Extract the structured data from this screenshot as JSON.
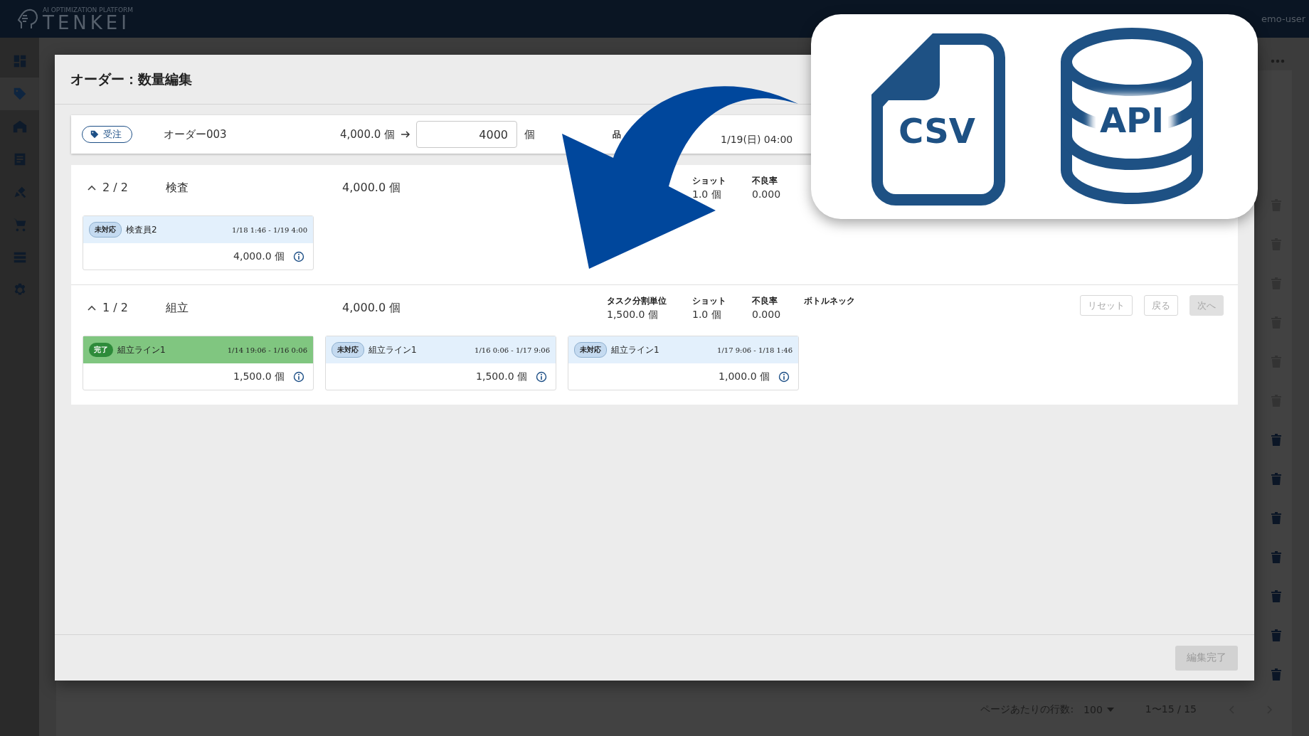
{
  "app": {
    "logo_subtitle": "AI OPTIMIZATION PLATFORM",
    "logo": "TENKEI",
    "user": "emo-user"
  },
  "sidebar": {
    "items": [
      {
        "selected": false
      },
      {
        "selected": true
      },
      {
        "selected": false
      },
      {
        "selected": false
      },
      {
        "selected": false
      },
      {
        "selected": false
      },
      {
        "selected": false
      },
      {
        "selected": false
      }
    ]
  },
  "background": {
    "rows": [
      {
        "disabled": true
      },
      {
        "disabled": true
      },
      {
        "disabled": true
      },
      {
        "disabled": true
      },
      {
        "disabled": true
      },
      {
        "disabled": true
      },
      {
        "disabled": false
      },
      {
        "disabled": false
      },
      {
        "disabled": false
      },
      {
        "disabled": false
      },
      {
        "disabled": false
      },
      {
        "disabled": false
      },
      {
        "disabled": false
      }
    ],
    "pagination": {
      "rows_label": "ページあたりの行数:",
      "rows_value": "100",
      "range": "1〜15 / 15"
    }
  },
  "modal": {
    "title": "オーダー：数量編集",
    "order": {
      "tag": "受注",
      "name": "オーダー003",
      "quantity": "4,000.0 個",
      "input_value": "4000",
      "unit": "個",
      "item_label": "品",
      "due": "1/19(日) 04:00"
    },
    "processes": [
      {
        "expanded": true,
        "step": "2 / 2",
        "name": "検査",
        "quantity": "4,000.0 個",
        "stats": [
          {
            "kind": "shot",
            "label": "ショット",
            "value": "1.0 個"
          },
          {
            "kind": "defect_rate",
            "label": "不良率",
            "value": "0.000"
          }
        ],
        "tasks": [
          {
            "kind": "pending",
            "badge": "未対応",
            "worker": "検査員2",
            "period": "1/18 1:46 - 1/19 4:00",
            "quantity": "4,000.0 個"
          }
        ]
      },
      {
        "expanded": true,
        "step": "1 / 2",
        "name": "組立",
        "quantity": "4,000.0 個",
        "stats": [
          {
            "kind": "split_unit",
            "label": "タスク分割単位",
            "value": "1,500.0 個"
          },
          {
            "kind": "shot",
            "label": "ショット",
            "value": "1.0 個"
          },
          {
            "kind": "defect_rate",
            "label": "不良率",
            "value": "0.000"
          },
          {
            "kind": "bottleneck",
            "label": "ボトルネック"
          }
        ],
        "buttons": [
          {
            "kind": "outline",
            "label": "リセット",
            "disabled": true
          },
          {
            "kind": "outline",
            "label": "戻る",
            "disabled": true
          },
          {
            "kind": "filled",
            "label": "次へ",
            "disabled": true
          }
        ],
        "tasks": [
          {
            "kind": "done",
            "badge": "完了",
            "worker": "組立ライン1",
            "period": "1/14 19:06 - 1/16 0:06",
            "quantity": "1,500.0 個"
          },
          {
            "kind": "pending",
            "badge": "未対応",
            "worker": "組立ライン1",
            "period": "1/16 0:06 - 1/17 9:06",
            "quantity": "1,500.0 個"
          },
          {
            "kind": "pending",
            "badge": "未対応",
            "worker": "組立ライン1",
            "period": "1/17 9:06 - 1/18 1:46",
            "quantity": "1,000.0 個"
          }
        ]
      }
    ],
    "footer": {
      "button": {
        "label": "編集完了",
        "disabled": true
      }
    }
  },
  "overlay": {
    "formats": [
      {
        "kind": "file",
        "label": "CSV"
      },
      {
        "kind": "database",
        "label": "API"
      }
    ]
  }
}
